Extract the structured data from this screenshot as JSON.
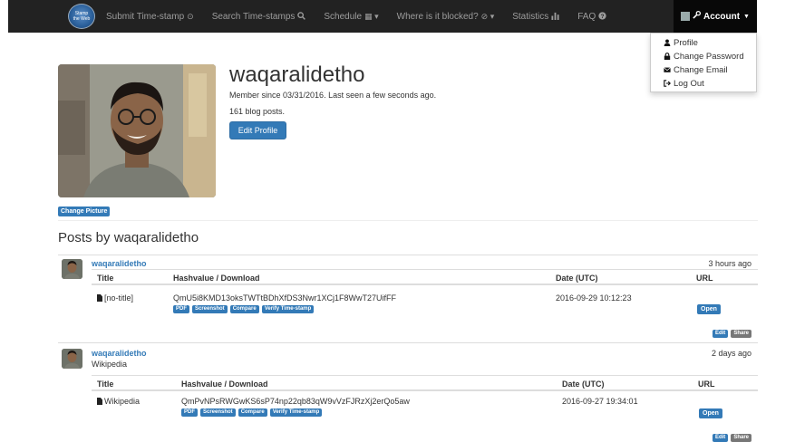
{
  "brand": {
    "line1": "Stamp",
    "line2": "the Web"
  },
  "nav": {
    "items": [
      {
        "label": "Submit Time-stamp",
        "icon": "clock-icon",
        "glyph": "⊙"
      },
      {
        "label": "Search Time-stamps",
        "icon": "search-icon",
        "glyph": "🔍"
      },
      {
        "label": "Schedule",
        "icon": "calendar-icon",
        "glyph": "▦ ▾"
      },
      {
        "label": "Where is it blocked?",
        "icon": "ban-icon",
        "glyph": "⊘ ▾"
      },
      {
        "label": "Statistics",
        "icon": "bar-chart-icon",
        "glyph": "▟"
      },
      {
        "label": "FAQ",
        "icon": "question-circle-icon",
        "glyph": "❓"
      }
    ],
    "account_label": "Account"
  },
  "account_menu": {
    "items": [
      {
        "label": "Profile",
        "icon": "user-icon",
        "glyph": "👤"
      },
      {
        "label": "Change Password",
        "icon": "lock-icon",
        "glyph": "🔒"
      },
      {
        "label": "Change Email",
        "icon": "envelope-icon",
        "glyph": "✉"
      },
      {
        "label": "Log Out",
        "icon": "logout-icon",
        "glyph": "⇥"
      }
    ]
  },
  "profile": {
    "username": "waqaralidetho",
    "member_text": "Member since 03/31/2016. Last seen a few seconds ago.",
    "blog_posts_text": "161 blog posts.",
    "edit_label": "Edit Profile",
    "change_picture_label": "Change Picture"
  },
  "posts_heading": "Posts by waqaralidetho",
  "table_headers": {
    "title": "Title",
    "hash": "Hashvalue / Download",
    "date": "Date (UTC)",
    "url": "URL"
  },
  "row_buttons": {
    "pdf": "PDF",
    "screenshot": "Screenshot",
    "compare": "Compare",
    "verify": "Verify Time-stamp",
    "open": "Open",
    "edit": "Edit",
    "share": "Share"
  },
  "posts": [
    {
      "author": "waqaralidetho",
      "subtitle": "",
      "ago": "3 hours ago",
      "title": "[no-title]",
      "hash": "QmU5i8KMD13oksTWTtBDhXfDS3Nwr1XCj1F8WwT27UifFF",
      "date": "2016-09-29 10:12:23"
    },
    {
      "author": "waqaralidetho",
      "subtitle": "Wikipedia",
      "ago": "2 days ago",
      "title": "Wikipedia",
      "hash": "QmPvNPsRWGwKS6sP74np22qb83qW9vVzFJRzXj2erQo5aw",
      "date": "2016-09-27 19:34:01"
    }
  ],
  "colors": {
    "navbar": "#222222",
    "primary": "#337ab7",
    "grey_label": "#777777"
  }
}
